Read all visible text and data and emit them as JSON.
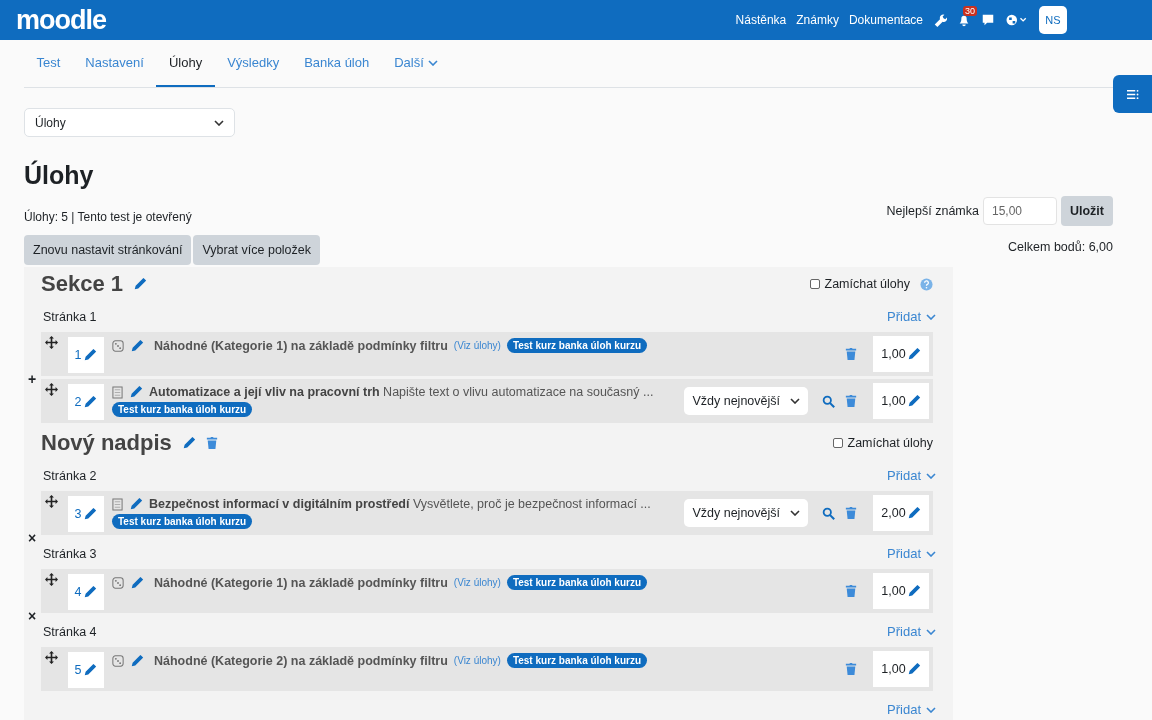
{
  "navbar": {
    "logo": "moodle",
    "links": [
      {
        "label": "Nástěnka"
      },
      {
        "label": "Známky"
      },
      {
        "label": "Dokumentace"
      }
    ],
    "notifications": "30",
    "avatar": "NS"
  },
  "tabs": [
    {
      "label": "Test",
      "selected": false,
      "menu": false
    },
    {
      "label": "Nastavení",
      "selected": false,
      "menu": false
    },
    {
      "label": "Úlohy",
      "selected": true,
      "menu": false
    },
    {
      "label": "Výsledky",
      "selected": false,
      "menu": false
    },
    {
      "label": "Banka úloh",
      "selected": false,
      "menu": false
    },
    {
      "label": "Další",
      "selected": false,
      "menu": true
    }
  ],
  "page_select": "Úlohy",
  "title": "Úlohy",
  "info": "Úlohy: 5 | Tento test je otevřený",
  "buttons": [
    "Znovu nastavit stránkování",
    "Vybrat více položek"
  ],
  "max_grade": {
    "label": "Nejlepší známka",
    "value": "15,00",
    "button": "Uložit"
  },
  "total": "Celkem bodů: 6,00",
  "sections": [
    {
      "title": "Sekce 1",
      "deletable": false,
      "help": true,
      "shuffle": {
        "label": "Zamíchat úlohy",
        "checked": false
      },
      "pages": [
        {
          "label": "Stránka 1",
          "add": "Přidat",
          "questions": [
            {
              "number": "1",
              "kind": "random",
              "title": "Náhodné (Kategorie 1) na základě podmínky filtru",
              "link": "(Viz úlohy)",
              "tag": "Test kurz banka úloh kurzu",
              "mark": "1,00",
              "break": "+"
            },
            {
              "number": "2",
              "kind": "essay",
              "title": "Automatizace a její vliv na pracovní trh",
              "text": "Napište text o vlivu automatizace na současný ...",
              "tag": "Test kurz banka úloh kurzu",
              "version": "Vždy nejnovější",
              "mark": "1,00"
            }
          ]
        }
      ]
    },
    {
      "title": "Nový nadpis",
      "deletable": true,
      "help": false,
      "shuffle": {
        "label": "Zamíchat úlohy",
        "checked": false
      },
      "add_end": "Přidat",
      "pages": [
        {
          "label": "Stránka 2",
          "add": "Přidat",
          "questions": [
            {
              "number": "3",
              "kind": "essay",
              "title": "Bezpečnost informací v digitálním prostředí",
              "text": "Vysvětlete, proč je bezpečnost informací ...",
              "tag": "Test kurz banka úloh kurzu",
              "version": "Vždy nejnovější",
              "mark": "2,00",
              "break": "×"
            }
          ]
        },
        {
          "label": "Stránka 3",
          "add": "Přidat",
          "questions": [
            {
              "number": "4",
              "kind": "random",
              "title": "Náhodné (Kategorie 1) na základě podmínky filtru",
              "link": "(Viz úlohy)",
              "tag": "Test kurz banka úloh kurzu",
              "mark": "1,00",
              "break": "×"
            }
          ]
        },
        {
          "label": "Stránka 4",
          "add": "Přidat",
          "questions": [
            {
              "number": "5",
              "kind": "random",
              "title": "Náhodné (Kategorie 2) na základě podmínky filtru",
              "link": "(Viz úlohy)",
              "tag": "Test kurz banka úloh kurzu",
              "mark": "1,00"
            }
          ]
        }
      ]
    }
  ]
}
